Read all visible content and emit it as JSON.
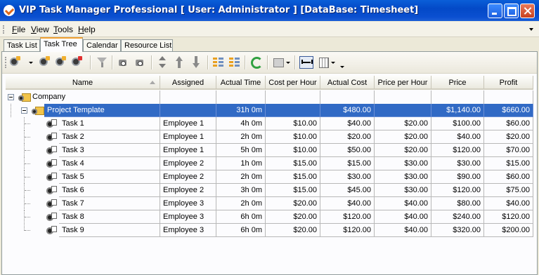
{
  "window": {
    "title": "VIP Task Manager Professional [ User: Administrator ] [DataBase: Timesheet]"
  },
  "menu": [
    {
      "label": "File"
    },
    {
      "label": "View"
    },
    {
      "label": "Tools"
    },
    {
      "label": "Help"
    }
  ],
  "tabs": [
    {
      "label": "Task List",
      "active": false
    },
    {
      "label": "Task Tree",
      "active": true
    },
    {
      "label": "Calendar",
      "active": false
    },
    {
      "label": "Resource List",
      "active": false
    }
  ],
  "toolbar": {
    "icons": [
      "add-user-icon",
      "user-icon",
      "edit-user-icon",
      "delete-user-icon",
      "filter-icon",
      "camera-icon",
      "camera-settings-icon",
      "move-up-down-icon",
      "move-up-icon",
      "move-down-icon",
      "expand-icon",
      "collapse-icon",
      "refresh-icon",
      "view-icon",
      "fit-columns-icon",
      "columns-icon"
    ]
  },
  "grid": {
    "columns": [
      "Name",
      "Assigned",
      "Actual Time",
      "Cost per Hour",
      "Actual Cost",
      "Price per Hour",
      "Price",
      "Profit"
    ],
    "company": {
      "name": "Company"
    },
    "project": {
      "name": "Project Template",
      "assigned": "",
      "actual_time": "31h 0m",
      "cost_per_hour": "",
      "actual_cost": "$480.00",
      "price_per_hour": "",
      "price": "$1,140.00",
      "profit": "$660.00"
    },
    "tasks": [
      {
        "name": "Task 1",
        "assigned": "Employee 1",
        "actual_time": "4h 0m",
        "cost_per_hour": "$10.00",
        "actual_cost": "$40.00",
        "price_per_hour": "$20.00",
        "price": "$100.00",
        "profit": "$60.00"
      },
      {
        "name": "Task 2",
        "assigned": "Employee 1",
        "actual_time": "2h 0m",
        "cost_per_hour": "$10.00",
        "actual_cost": "$20.00",
        "price_per_hour": "$20.00",
        "price": "$40.00",
        "profit": "$20.00"
      },
      {
        "name": "Task 3",
        "assigned": "Employee 1",
        "actual_time": "5h 0m",
        "cost_per_hour": "$10.00",
        "actual_cost": "$50.00",
        "price_per_hour": "$20.00",
        "price": "$120.00",
        "profit": "$70.00"
      },
      {
        "name": "Task 4",
        "assigned": "Employee 2",
        "actual_time": "1h 0m",
        "cost_per_hour": "$15.00",
        "actual_cost": "$15.00",
        "price_per_hour": "$30.00",
        "price": "$30.00",
        "profit": "$15.00"
      },
      {
        "name": "Task 5",
        "assigned": "Employee 2",
        "actual_time": "2h 0m",
        "cost_per_hour": "$15.00",
        "actual_cost": "$30.00",
        "price_per_hour": "$30.00",
        "price": "$90.00",
        "profit": "$60.00"
      },
      {
        "name": "Task 6",
        "assigned": "Employee 2",
        "actual_time": "3h 0m",
        "cost_per_hour": "$15.00",
        "actual_cost": "$45.00",
        "price_per_hour": "$30.00",
        "price": "$120.00",
        "profit": "$75.00"
      },
      {
        "name": "Task 7",
        "assigned": "Employee 3",
        "actual_time": "2h 0m",
        "cost_per_hour": "$20.00",
        "actual_cost": "$40.00",
        "price_per_hour": "$40.00",
        "price": "$80.00",
        "profit": "$40.00"
      },
      {
        "name": "Task 8",
        "assigned": "Employee 3",
        "actual_time": "6h 0m",
        "cost_per_hour": "$20.00",
        "actual_cost": "$120.00",
        "price_per_hour": "$40.00",
        "price": "$240.00",
        "profit": "$120.00"
      },
      {
        "name": "Task 9",
        "assigned": "Employee 3",
        "actual_time": "6h 0m",
        "cost_per_hour": "$20.00",
        "actual_cost": "$120.00",
        "price_per_hour": "$40.00",
        "price": "$320.00",
        "profit": "$200.00"
      }
    ]
  },
  "colors": {
    "titlebar": "#0349c7",
    "selection": "#316ac5",
    "active_tab_accent": "#f0a030"
  }
}
